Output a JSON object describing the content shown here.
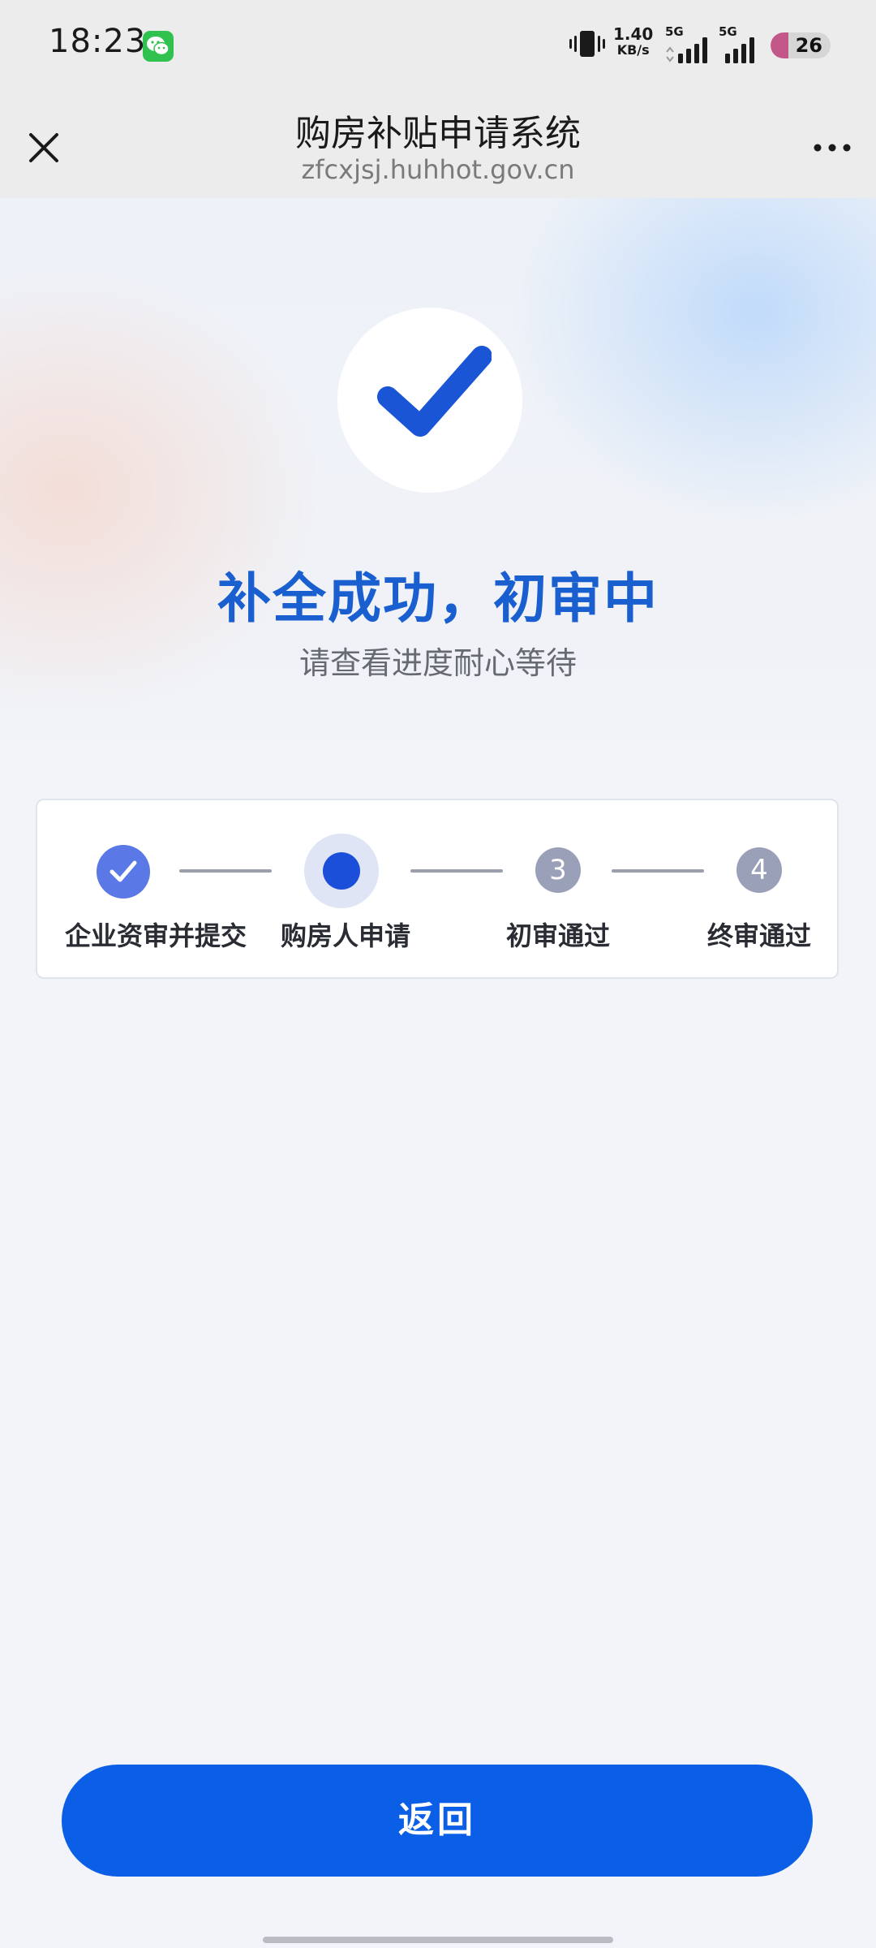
{
  "status_bar": {
    "time": "18:23",
    "net_speed_value": "1.40",
    "net_speed_unit": "KB/s",
    "signal1_label": "5G",
    "signal2_label": "5G",
    "battery": "26",
    "battery_level_percent": 26,
    "battery_color": "#c4578a"
  },
  "nav": {
    "title": "购房补贴申请系统",
    "url": "zfcxjsj.huhhot.gov.cn",
    "close_icon": "close-icon",
    "more_icon": "more-icon"
  },
  "hero": {
    "icon": "checkmark-icon",
    "title": "补全成功，初审中",
    "subtitle": "请查看进度耐心等待",
    "title_color": "#1a5fcf"
  },
  "steps": [
    {
      "label": "企业资审并提交",
      "state": "done"
    },
    {
      "label": "购房人申请",
      "state": "current"
    },
    {
      "label": "初审通过",
      "state": "pending",
      "number": "3"
    },
    {
      "label": "终审通过",
      "state": "pending",
      "number": "4"
    }
  ],
  "footer": {
    "back_label": "返回",
    "accent_color": "#0a5fe6"
  }
}
